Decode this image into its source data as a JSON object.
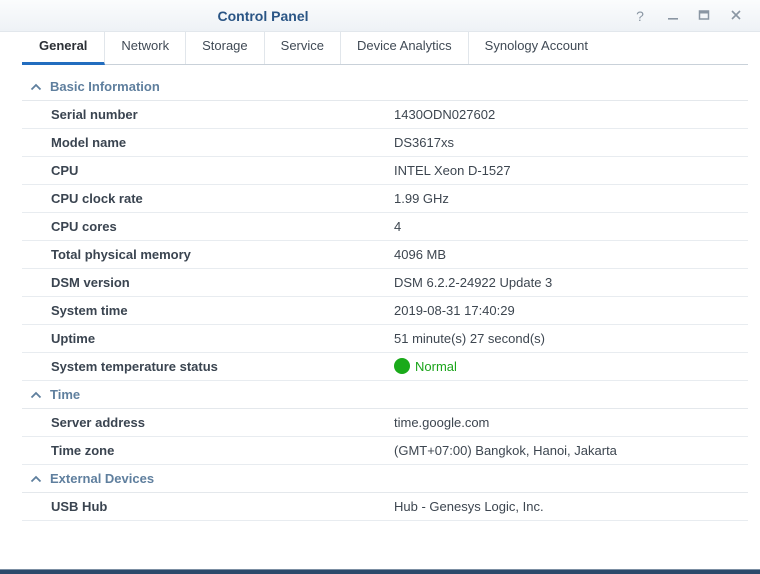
{
  "window": {
    "title": "Control Panel",
    "help_glyph": "?"
  },
  "tabs": [
    {
      "label": "General",
      "active": true
    },
    {
      "label": "Network",
      "active": false
    },
    {
      "label": "Storage",
      "active": false
    },
    {
      "label": "Service",
      "active": false
    },
    {
      "label": "Device Analytics",
      "active": false
    },
    {
      "label": "Synology Account",
      "active": false
    }
  ],
  "sections": {
    "basic": {
      "title": "Basic Information",
      "rows": [
        {
          "label": "Serial number",
          "value": "1430ODN027602"
        },
        {
          "label": "Model name",
          "value": "DS3617xs"
        },
        {
          "label": "CPU",
          "value": "INTEL Xeon D-1527"
        },
        {
          "label": "CPU clock rate",
          "value": "1.99 GHz"
        },
        {
          "label": "CPU cores",
          "value": "4"
        },
        {
          "label": "Total physical memory",
          "value": "4096 MB"
        },
        {
          "label": "DSM version",
          "value": "DSM 6.2.2-24922 Update 3"
        },
        {
          "label": "System time",
          "value": "2019-08-31 17:40:29"
        },
        {
          "label": "Uptime",
          "value": "51 minute(s) 27 second(s)"
        },
        {
          "label": "System temperature status",
          "value": "Normal"
        }
      ]
    },
    "time": {
      "title": "Time",
      "rows": [
        {
          "label": "Server address",
          "value": "time.google.com"
        },
        {
          "label": "Time zone",
          "value": "(GMT+07:00) Bangkok, Hanoi, Jakarta"
        }
      ]
    },
    "external": {
      "title": "External Devices",
      "rows": [
        {
          "label": "USB Hub",
          "value": "Hub - Genesys Logic, Inc."
        }
      ]
    }
  },
  "colors": {
    "accent": "#226dbf",
    "title": "#2a5585",
    "section_header": "#5f7f9e",
    "status_normal": "#1aaa1a"
  },
  "icons": {
    "help": "help-icon",
    "minimize": "minimize-icon",
    "maximize": "maximize-icon",
    "close": "close-icon",
    "section_toggle": "chevron-up-icon",
    "status": "status-dot-icon"
  }
}
